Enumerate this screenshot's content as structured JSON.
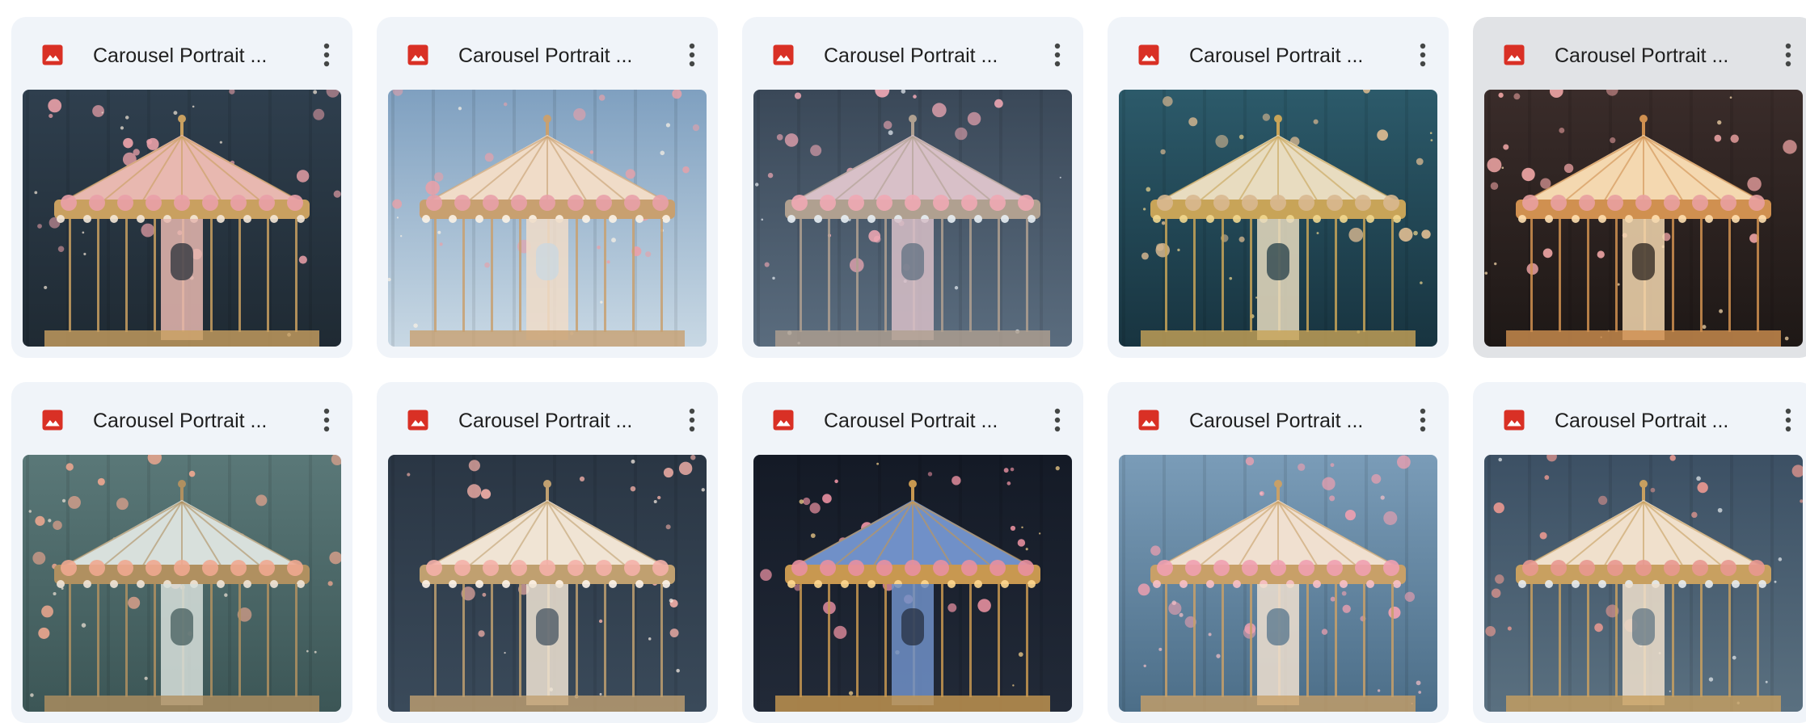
{
  "files": [
    {
      "title": "Carousel Portrait ...",
      "type_icon": "image-file-icon",
      "selected": false,
      "thumb": {
        "sky": "#2f3f4e",
        "bg2": "#1f2a33",
        "canopy": "#e8b8b0",
        "trim": "#c9a060",
        "flowers": "#e9a0a8",
        "accent": "#f5e8d8"
      }
    },
    {
      "title": "Carousel Portrait ...",
      "type_icon": "image-file-icon",
      "selected": false,
      "thumb": {
        "sky": "#7fa0c0",
        "bg2": "#c8d8e4",
        "canopy": "#f0dcc8",
        "trim": "#c8a070",
        "flowers": "#e8a0a8",
        "accent": "#fbf2e6"
      }
    },
    {
      "title": "Carousel Portrait ...",
      "type_icon": "image-file-icon",
      "selected": false,
      "thumb": {
        "sky": "#3a4858",
        "bg2": "#5a6c7e",
        "canopy": "#d8c0c8",
        "trim": "#b0a090",
        "flowers": "#f0a8b4",
        "accent": "#e8eef4"
      }
    },
    {
      "title": "Carousel Portrait ...",
      "type_icon": "image-file-icon",
      "selected": false,
      "thumb": {
        "sky": "#2c5a6a",
        "bg2": "#183440",
        "canopy": "#e8dcc0",
        "trim": "#c8a458",
        "flowers": "#d8b890",
        "accent": "#f2d890"
      }
    },
    {
      "title": "Carousel Portrait ...",
      "type_icon": "image-file-icon",
      "selected": true,
      "thumb": {
        "sky": "#3a2c2a",
        "bg2": "#1e1816",
        "canopy": "#f4d8b0",
        "trim": "#d09050",
        "flowers": "#e8a0a0",
        "accent": "#ffe0b0"
      }
    },
    {
      "title": "Carousel Portrait ...",
      "type_icon": "image-file-icon",
      "selected": false,
      "thumb": {
        "sky": "#5a7878",
        "bg2": "#3c5656",
        "canopy": "#d8e0dc",
        "trim": "#b09060",
        "flowers": "#f0a890",
        "accent": "#f2e6d8"
      }
    },
    {
      "title": "Carousel Portrait ...",
      "type_icon": "image-file-icon",
      "selected": false,
      "thumb": {
        "sky": "#2a3644",
        "bg2": "#3a4a5a",
        "canopy": "#f0e4d4",
        "trim": "#c0a070",
        "flowers": "#f4b0a8",
        "accent": "#fff4ea"
      }
    },
    {
      "title": "Carousel Portrait ...",
      "type_icon": "image-file-icon",
      "selected": false,
      "thumb": {
        "sky": "#141a26",
        "bg2": "#222a38",
        "canopy": "#7090c8",
        "trim": "#c89850",
        "flowers": "#e890a0",
        "accent": "#ffd890"
      }
    },
    {
      "title": "Carousel Portrait ...",
      "type_icon": "image-file-icon",
      "selected": false,
      "thumb": {
        "sky": "#7a9cb8",
        "bg2": "#4c6e88",
        "canopy": "#f0e0d0",
        "trim": "#c8a068",
        "flowers": "#f0a0b0",
        "accent": "#f8c0c8"
      }
    },
    {
      "title": "Carousel Portrait ...",
      "type_icon": "image-file-icon",
      "selected": false,
      "thumb": {
        "sky": "#3c5064",
        "bg2": "#5a7080",
        "canopy": "#f0e0cc",
        "trim": "#c8a060",
        "flowers": "#e89890",
        "accent": "#e8ecf0"
      }
    }
  ],
  "colors": {
    "card_bg": "#f0f4f9",
    "card_selected_bg": "#e1e3e6",
    "image_icon": "#d93025",
    "title_text": "#1f1f1f",
    "more_icon": "#444746"
  },
  "more_icon_name": "more-vert-icon"
}
